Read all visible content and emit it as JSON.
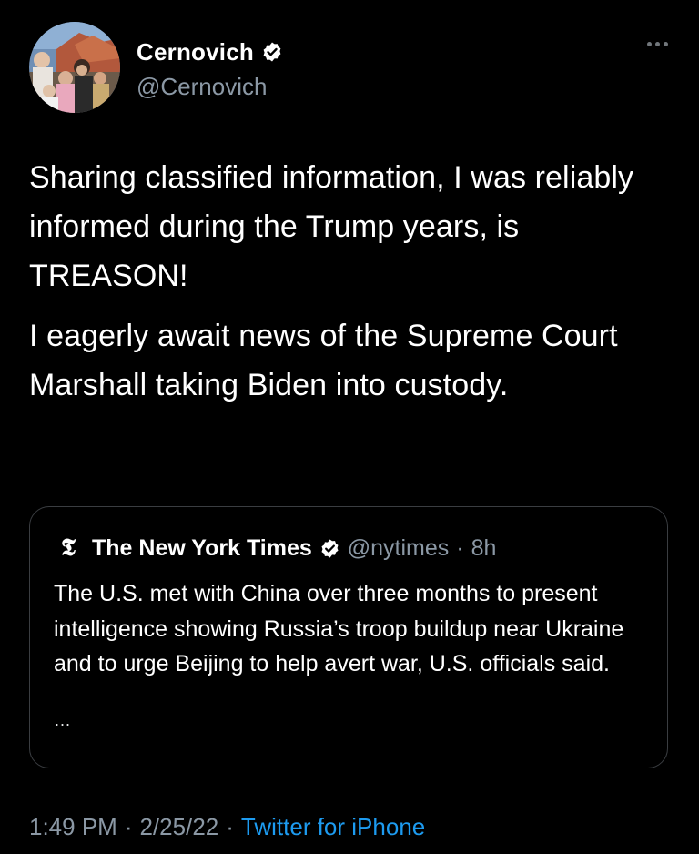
{
  "author": {
    "display_name": "Cernovich",
    "handle": "@Cernovich",
    "verified": true
  },
  "tweet": {
    "paragraphs": [
      "Sharing classified information, I was reliably informed during the Trump years, is TREASON!",
      "I eagerly await news of the Supreme Court Marshall taking Biden into custody."
    ]
  },
  "quote": {
    "logo": "𝕿",
    "name": "The New York Times",
    "verified": true,
    "handle": "@nytimes",
    "separator": "·",
    "time": "8h",
    "text": "The U.S. met with China over three months to present intelligence showing Russia’s troop buildup near Ukraine and to urge Beijing to help avert war, U.S. officials said.",
    "ellipsis": "..."
  },
  "meta": {
    "time": "1:49 PM",
    "sep1": "·",
    "date": "2/25/22",
    "sep2": "·",
    "source": "Twitter for iPhone"
  },
  "icons": {
    "verified": "verified-badge-icon",
    "more": "more-options-icon"
  },
  "colors": {
    "background": "#000000",
    "text": "#ffffff",
    "secondary": "#8b98a5",
    "link": "#1d9bf0",
    "border": "#3a3d41"
  }
}
